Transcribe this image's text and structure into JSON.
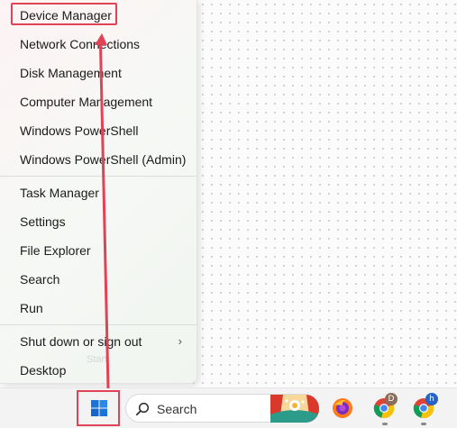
{
  "menu": {
    "items": [
      {
        "label": "Device Manager"
      },
      {
        "label": "Network Connections"
      },
      {
        "label": "Disk Management"
      },
      {
        "label": "Computer Management"
      },
      {
        "label": "Windows PowerShell"
      },
      {
        "label": "Windows PowerShell (Admin)"
      },
      {
        "label": "Task Manager"
      },
      {
        "label": "Settings"
      },
      {
        "label": "File Explorer"
      },
      {
        "label": "Search"
      },
      {
        "label": "Run"
      },
      {
        "label": "Shut down or sign out",
        "submenu": true
      },
      {
        "label": "Desktop"
      }
    ],
    "ghost_text": "Start"
  },
  "taskbar": {
    "search_label": "Search",
    "chrome_profile_1_initial": "D",
    "chrome_profile_2_initial": "h",
    "icons": [
      "windows-start-icon",
      "search-icon",
      "firefox-icon",
      "chrome-icon",
      "chrome-icon"
    ]
  },
  "colors": {
    "highlight": "#e04356",
    "menu_text": "#1b1b1b",
    "taskbar": "#f3f3f3"
  }
}
